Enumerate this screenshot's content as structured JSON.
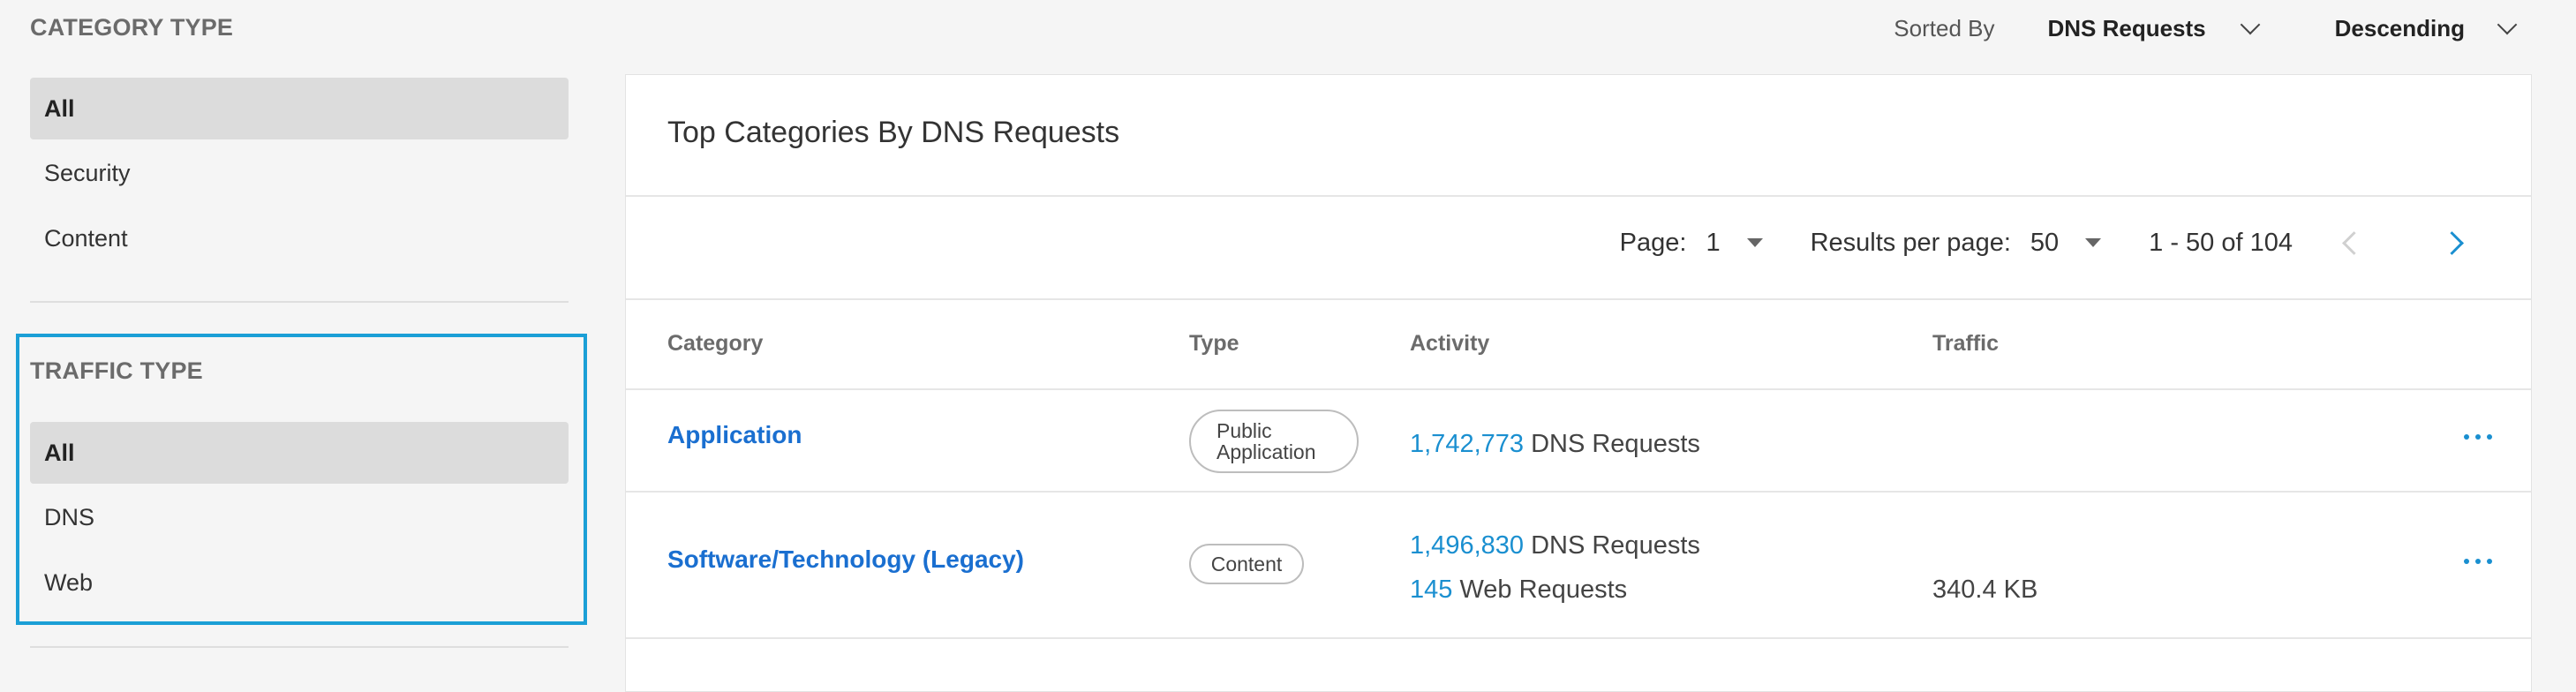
{
  "sort": {
    "label": "Sorted By",
    "field": "DNS Requests",
    "direction": "Descending"
  },
  "sidebar": {
    "category_type": {
      "title": "CATEGORY TYPE",
      "items": [
        "All",
        "Security",
        "Content"
      ],
      "selected": "All"
    },
    "traffic_type": {
      "title": "TRAFFIC TYPE",
      "items": [
        "All",
        "DNS",
        "Web"
      ],
      "selected": "All"
    }
  },
  "card": {
    "title": "Top Categories By DNS Requests",
    "pagination": {
      "page_label": "Page:",
      "page_value": "1",
      "per_page_label": "Results per page:",
      "per_page_value": "50",
      "range": "1 - 50 of 104"
    },
    "columns": [
      "Category",
      "Type",
      "Activity",
      "Traffic"
    ],
    "rows": [
      {
        "category": "Application",
        "type": "Public Application",
        "activity": [
          {
            "count": "1,742,773",
            "label": "DNS Requests"
          }
        ],
        "traffic": ""
      },
      {
        "category": "Software/Technology (Legacy)",
        "type": "Content",
        "activity": [
          {
            "count": "1,496,830",
            "label": "DNS Requests"
          },
          {
            "count": "145",
            "label": "Web Requests"
          }
        ],
        "traffic": "340.4 KB"
      }
    ]
  },
  "colors": {
    "accent": "#1a8fd0",
    "link": "#1a6fd0",
    "highlight_border": "#1b9fd6"
  }
}
